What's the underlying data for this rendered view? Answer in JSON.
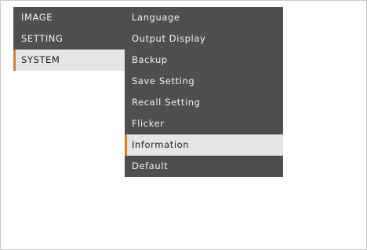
{
  "main_menu": {
    "items": [
      {
        "label": "IMAGE"
      },
      {
        "label": "SETTING"
      },
      {
        "label": "SYSTEM"
      }
    ],
    "selected_index": 2
  },
  "sub_menu": {
    "items": [
      {
        "label": "Language"
      },
      {
        "label": "Output Display"
      },
      {
        "label": "Backup"
      },
      {
        "label": "Save Setting"
      },
      {
        "label": "Recall Setting"
      },
      {
        "label": "Flicker"
      },
      {
        "label": "Information"
      },
      {
        "label": "Default"
      }
    ],
    "selected_index": 6
  },
  "colors": {
    "menu_background": "#4f4f51",
    "menu_text": "#f2f2f2",
    "selected_background": "#e6e6e6",
    "selected_text": "#1c1c1c",
    "accent": "#e07b1f"
  }
}
